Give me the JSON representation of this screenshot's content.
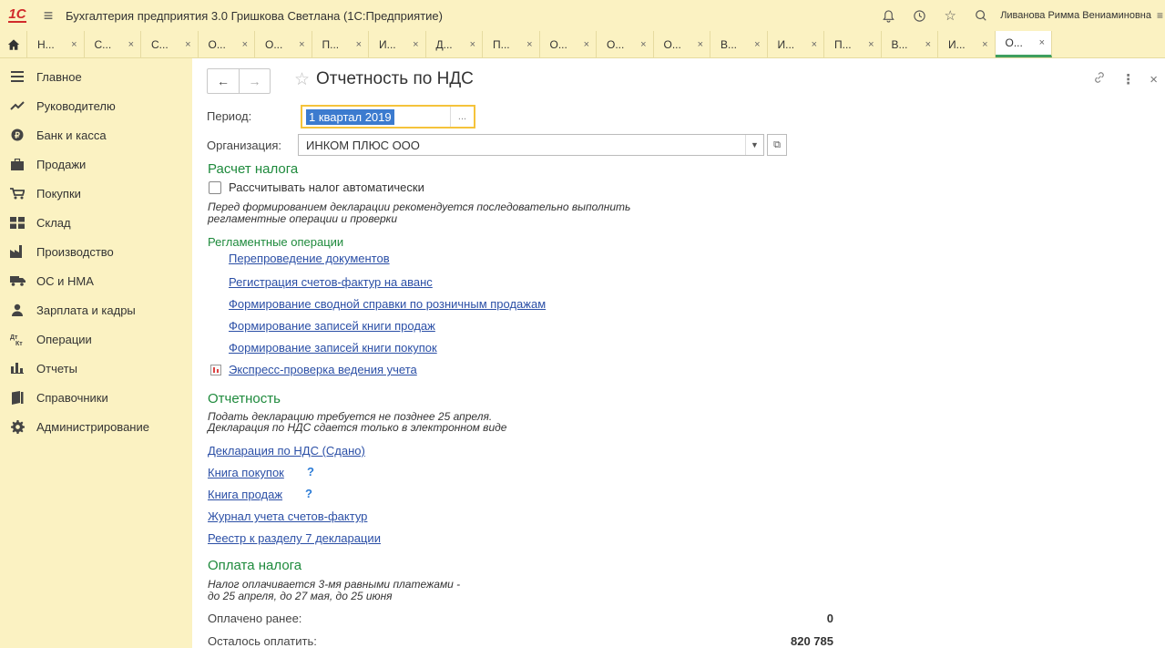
{
  "titlebar": {
    "logo_text": "1С",
    "app_title": "Бухгалтерия предприятия 3.0 Гришкова Светлана  (1С:Предприятие)",
    "user_name": "Ливанова Римма Вениаминовна"
  },
  "tabs": [
    {
      "label": "Н..."
    },
    {
      "label": "С..."
    },
    {
      "label": "С..."
    },
    {
      "label": "О..."
    },
    {
      "label": "О..."
    },
    {
      "label": "П..."
    },
    {
      "label": "И..."
    },
    {
      "label": "Д..."
    },
    {
      "label": "П..."
    },
    {
      "label": "О..."
    },
    {
      "label": "О..."
    },
    {
      "label": "О..."
    },
    {
      "label": "В..."
    },
    {
      "label": "И..."
    },
    {
      "label": "П..."
    },
    {
      "label": "В..."
    },
    {
      "label": "И..."
    },
    {
      "label": "О..."
    }
  ],
  "tab_close": "×",
  "sidebar": {
    "items": [
      {
        "label": "Главное",
        "icon": "menu-lines-icon"
      },
      {
        "label": "Руководителю",
        "icon": "trend-icon"
      },
      {
        "label": "Банк и касса",
        "icon": "coin-icon"
      },
      {
        "label": "Продажи",
        "icon": "briefcase-icon"
      },
      {
        "label": "Покупки",
        "icon": "cart-icon"
      },
      {
        "label": "Склад",
        "icon": "warehouse-icon"
      },
      {
        "label": "Производство",
        "icon": "factory-icon"
      },
      {
        "label": "ОС и НМА",
        "icon": "truck-icon"
      },
      {
        "label": "Зарплата и кадры",
        "icon": "person-icon"
      },
      {
        "label": "Операции",
        "icon": "dt-kt-icon"
      },
      {
        "label": "Отчеты",
        "icon": "bar-chart-icon"
      },
      {
        "label": "Справочники",
        "icon": "book-icon"
      },
      {
        "label": "Администрирование",
        "icon": "gear-icon"
      }
    ]
  },
  "header": {
    "title": "Отчетность по НДС"
  },
  "form": {
    "period_label": "Период:",
    "period_value": "1 квартал 2019",
    "period_dots": "...",
    "org_label": "Организация:",
    "org_value": "ИНКОМ ПЛЮС ООО"
  },
  "tax_calc": {
    "title": "Расчет налога",
    "auto_checkbox": "Рассчитывать налог автоматически",
    "note_line1": "Перед формированием декларации рекомендуется последовательно выполнить",
    "note_line2": "регламентные операции и проверки",
    "ops_title": "Регламентные операции",
    "links": [
      "Перепроведение документов",
      "Регистрация счетов-фактур на аванс",
      "Формирование сводной справки по розничным продажам",
      "Формирование записей книги продаж",
      "Формирование записей книги покупок"
    ],
    "express_check": "Экспресс-проверка ведения учета"
  },
  "reporting": {
    "title": "Отчетность",
    "note_line1": "Подать декларацию требуется не позднее 25 апреля.",
    "note_line2": "Декларация по НДС сдается только в электронном виде",
    "declaration": "Декларация по НДС (Сдано)",
    "purchase_book": "Книга покупок",
    "sales_book": "Книга продаж",
    "help_mark": "?",
    "invoice_journal": "Журнал учета счетов-фактур",
    "registry": "Реестр к разделу 7 декларации"
  },
  "payment": {
    "title": "Оплата налога",
    "note_line1": "Налог оплачивается 3-мя равными платежами -",
    "note_line2": "до 25 апреля, до 27 мая, до 25 июня",
    "paid_label": "Оплачено ранее:",
    "paid_value": "0",
    "remaining_label": "Осталось оплатить:",
    "remaining_value": "820 785"
  },
  "colors": {
    "panel_bg": "#fbf2c2",
    "section_green": "#1e8a3c",
    "link_blue": "#2b4fa6",
    "focus_yellow": "#f5c33b",
    "selection_blue": "#3c7bcf"
  }
}
